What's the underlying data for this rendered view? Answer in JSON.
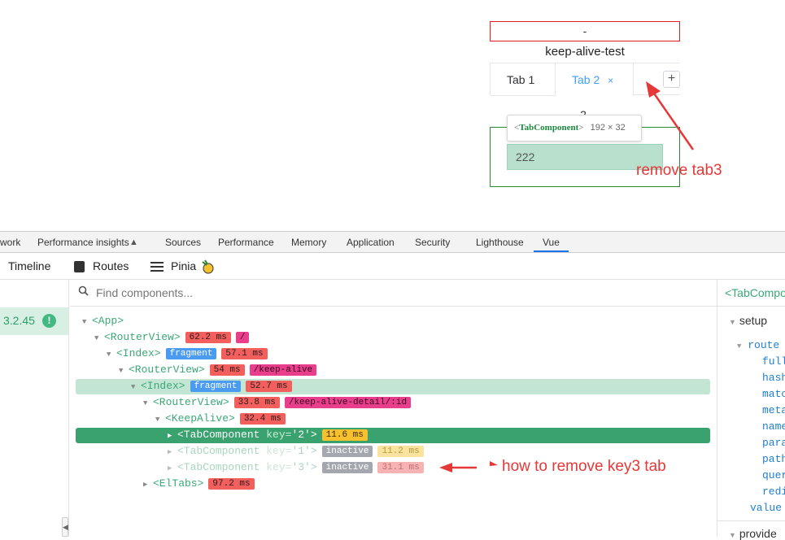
{
  "page": {
    "dash_text": "-",
    "app_title": "keep-alive-test",
    "tabs": [
      {
        "label": "Tab 1",
        "active": false
      },
      {
        "label": "Tab 2",
        "active": true,
        "close": "×"
      }
    ],
    "add_tab": "+",
    "panel_value": "2",
    "input_value": "222"
  },
  "tooltip": {
    "open": "<",
    "component": "TabComponent",
    "close": ">",
    "size": "192 × 32"
  },
  "annotations": {
    "remove_tab3": "remove tab3",
    "how_to_remove": "how to remove key3 tab"
  },
  "devtools": {
    "tabs": [
      "work",
      "Performance insights",
      "Sources",
      "Performance",
      "Memory",
      "Application",
      "Security",
      "Lighthouse",
      "Vue"
    ],
    "active_tab": "Vue",
    "vue_toolbar": {
      "timeline": "Timeline",
      "routes": "Routes",
      "pinia": "Pinia"
    },
    "version": "3.2.45",
    "search_placeholder": "Find components...",
    "tree": [
      {
        "label": "<App>",
        "badges": []
      },
      {
        "label": "<RouterView>",
        "badges": [
          {
            "text": "62.2 ms",
            "kind": "time"
          },
          {
            "text": "/",
            "kind": "route"
          }
        ]
      },
      {
        "label": "<Index>",
        "badges": [
          {
            "text": "fragment",
            "kind": "frag"
          },
          {
            "text": "57.1 ms",
            "kind": "time"
          }
        ]
      },
      {
        "label": "<RouterView>",
        "badges": [
          {
            "text": "54 ms",
            "kind": "time"
          },
          {
            "text": "/keep-alive",
            "kind": "route"
          }
        ]
      },
      {
        "label": "<Index>",
        "badges": [
          {
            "text": "fragment",
            "kind": "frag"
          },
          {
            "text": "52.7 ms",
            "kind": "time"
          }
        ]
      },
      {
        "label": "<RouterView>",
        "badges": [
          {
            "text": "33.8 ms",
            "kind": "time"
          },
          {
            "text": "/keep-alive-detail/:id",
            "kind": "route"
          }
        ]
      },
      {
        "label": "<KeepAlive>",
        "badges": [
          {
            "text": "32.4 ms",
            "kind": "time"
          }
        ]
      },
      {
        "label": "<TabComponent",
        "key_text": " key=",
        "key_val": "'2'",
        "end": ">",
        "badges": [
          {
            "text": "11.6 ms",
            "kind": "yellow"
          }
        ]
      },
      {
        "label": "<TabComponent",
        "key_text": " key=",
        "key_val": "'1'",
        "end": ">",
        "badges": [
          {
            "text": "inactive",
            "kind": "inact"
          },
          {
            "text": "11.2 ms",
            "kind": "yellow-f"
          }
        ]
      },
      {
        "label": "<TabComponent",
        "key_text": " key=",
        "key_val": "'3'",
        "end": ">",
        "badges": [
          {
            "text": "inactive",
            "kind": "inact"
          },
          {
            "text": "31.1 ms",
            "kind": "time-f"
          }
        ]
      },
      {
        "label": "<ElTabs>",
        "badges": [
          {
            "text": "97.2 ms",
            "kind": "time"
          }
        ]
      }
    ],
    "right_panel": {
      "header": "<TabCompo",
      "setup": "setup",
      "route": "route",
      "fields": [
        "full",
        "hash",
        "matc",
        "meta",
        "name",
        "para",
        "path",
        "quer",
        "redi"
      ],
      "value": "value",
      "provided": "provide"
    }
  },
  "colors": {
    "vue_green": "#42b883",
    "time_badge": "#f25f5c",
    "route_badge": "#e83e8c",
    "fragment_badge": "#4b9bf0",
    "annotation_red": "#e53838",
    "tab_active": "#409eff"
  }
}
